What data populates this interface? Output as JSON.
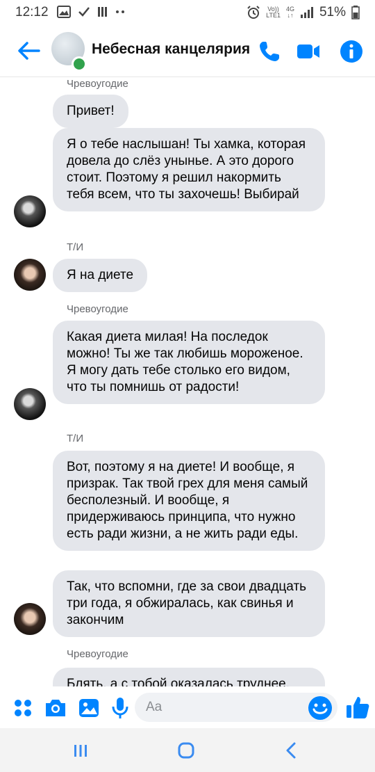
{
  "status_bar": {
    "time": "12:12",
    "volte_label": "Vo))",
    "lte_label": "LTE1",
    "network_label": "4G",
    "battery_percent": "51%"
  },
  "header": {
    "title": "Небесная канцелярия",
    "online": true,
    "accent_color": "#0084ff"
  },
  "messages": [
    {
      "type": "sender",
      "text": "Чревоугодие"
    },
    {
      "type": "bubble",
      "side": "left",
      "text": "Привет!"
    },
    {
      "type": "bubble",
      "side": "left",
      "text": "Я о тебе наслышан! Ты хамка, которая довела до слёз унынье. А это дорого стоит. Поэтому я решил накормить тебя всем, что ты захочешь! Выбирай",
      "avatar": "bot"
    },
    {
      "type": "sender",
      "text": "Т/И"
    },
    {
      "type": "bubble",
      "side": "left",
      "text": "Я на диете",
      "avatar": "user"
    },
    {
      "type": "sender",
      "text": "Чревоугодие"
    },
    {
      "type": "bubble",
      "side": "left",
      "text": "Какая диета милая! На последок можно! Ты же так любишь мороженое. Я могу дать тебе столько его видом, что ты помнишь от радости!",
      "avatar": "bot"
    },
    {
      "type": "sender",
      "text": "Т/И"
    },
    {
      "type": "bubble",
      "side": "left",
      "text": "Вот, поэтому я на диете! И вообще, я призрак. Так твой грех для меня самый бесполезный. И вообще, я придерживаюсь принципа, что нужно есть ради жизни, а не жить ради еды."
    },
    {
      "type": "bubble",
      "side": "left",
      "text": "Так, что вспомни, где за свои двадцать три года, я обжиралась, как свинья и закончим",
      "avatar": "user"
    },
    {
      "type": "sender",
      "text": "Чревоугодие"
    },
    {
      "type": "bubble",
      "side": "left",
      "text": "Блять, а с тобой оказалась труднее."
    }
  ],
  "composer": {
    "placeholder": "Aa",
    "icons": [
      "apps-icon",
      "camera-icon",
      "gallery-icon",
      "microphone-icon",
      "emoji-icon",
      "thumbs-up-icon"
    ]
  },
  "nav_bar": {
    "icons": [
      "recent-apps-icon",
      "home-icon",
      "back-nav-icon"
    ]
  }
}
